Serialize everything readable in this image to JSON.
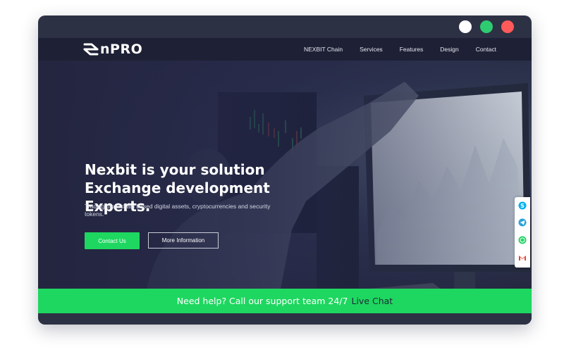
{
  "window": {
    "title_dots": [
      {
        "name": "white-dot",
        "color": "#ffffff"
      },
      {
        "name": "green-dot",
        "color": "#2ecc71"
      },
      {
        "name": "red-dot",
        "color": "#ff5a5a"
      }
    ]
  },
  "brand": {
    "logo_text": "nPRO"
  },
  "nav": {
    "items": [
      "NEXBIT Chain",
      "Services",
      "Features",
      "Design",
      "Contact"
    ]
  },
  "hero": {
    "headline": [
      "Nexbit is your solution",
      "Exchange development",
      "Experts."
    ],
    "subtext": "Trading blockchain based digital assets, cryptocurrencies and security tokens.",
    "primary_button": "Contact Us",
    "secondary_button": "More Information"
  },
  "social": {
    "icons": [
      "skype-icon",
      "telegram-icon",
      "whatsapp-icon",
      "gmail-icon"
    ]
  },
  "help": {
    "text": "Need help? Call our support team 24/7",
    "link": "Live Chat"
  },
  "colors": {
    "accent": "#1ed760",
    "navbar": "#1e2035",
    "frame": "#2d3144"
  }
}
